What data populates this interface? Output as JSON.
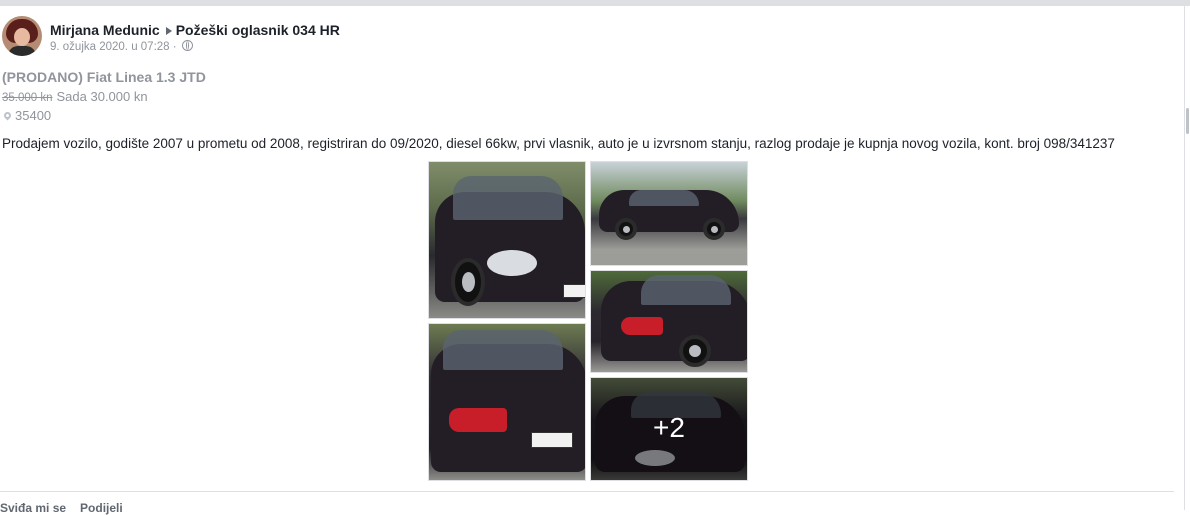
{
  "post": {
    "author": "Mirjana Medunic",
    "group": "Požeški oglasnik 034 HR",
    "timestamp": "9. ožujka 2020. u 07:28 ·"
  },
  "listing": {
    "title": "(PRODANO) Fiat Linea 1.3 JTD",
    "old_price": "35.000 kn",
    "new_price": "Sada 30.000 kn",
    "location": "35400",
    "description": "Prodajem vozilo, godište 2007 u prometu od 2008, registriran do 09/2020, diesel 66kw, prvi vlasnik, auto je u izvrsnom stanju, razlog prodaje je kupnja novog vozila, kont. broj 098/341237"
  },
  "gallery": {
    "more_count": "+2"
  },
  "actions": {
    "like": "Sviđa mi se",
    "share": "Podijeli"
  },
  "icons": {
    "privacy": "globe-icon",
    "location": "location-pin-icon",
    "separator": "triangle-right-icon"
  }
}
